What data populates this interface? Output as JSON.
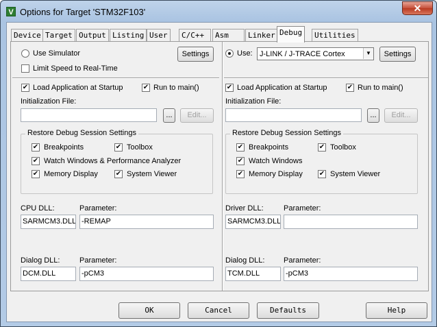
{
  "window": {
    "title": "Options for Target 'STM32F103'",
    "close_glyph": "✕",
    "app_icon_letter": "V"
  },
  "tabs": [
    {
      "label": "Device"
    },
    {
      "label": "Target"
    },
    {
      "label": "Output"
    },
    {
      "label": "Listing"
    },
    {
      "label": "User"
    },
    {
      "label": "C/C++"
    },
    {
      "label": "Asm"
    },
    {
      "label": "Linker"
    },
    {
      "label": "Debug"
    },
    {
      "label": "Utilities"
    }
  ],
  "active_tab": "Debug",
  "left": {
    "use_simulator_label": "Use Simulator",
    "use_simulator_selected": false,
    "settings_label": "Settings",
    "limit_speed_label": "Limit Speed to Real-Time",
    "limit_speed_checked": false,
    "load_app_label": "Load Application at Startup",
    "load_app_checked": true,
    "run_to_main_label": "Run to main()",
    "run_to_main_checked": true,
    "init_file_label": "Initialization File:",
    "init_file_value": "",
    "browse_label": "...",
    "edit_label": "Edit...",
    "restore_group_title": "Restore Debug Session Settings",
    "breakpoints_label": "Breakpoints",
    "toolbox_label": "Toolbox",
    "watch_label": "Watch Windows & Performance Analyzer",
    "memory_label": "Memory Display",
    "system_viewer_label": "System Viewer",
    "cpu_dll_label": "CPU DLL:",
    "cpu_dll_value": "SARMCM3.DLL",
    "cpu_param_label": "Parameter:",
    "cpu_param_value": "-REMAP",
    "dialog_dll_label": "Dialog DLL:",
    "dialog_dll_value": "DCM.DLL",
    "dialog_param_label": "Parameter:",
    "dialog_param_value": "-pCM3"
  },
  "right": {
    "use_label": "Use:",
    "use_selected": true,
    "debugger_value": "J-LINK / J-TRACE Cortex",
    "settings_label": "Settings",
    "load_app_label": "Load Application at Startup",
    "load_app_checked": true,
    "run_to_main_label": "Run to main()",
    "run_to_main_checked": true,
    "init_file_label": "Initialization File:",
    "init_file_value": "",
    "browse_label": "...",
    "edit_label": "Edit...",
    "restore_group_title": "Restore Debug Session Settings",
    "breakpoints_label": "Breakpoints",
    "toolbox_label": "Toolbox",
    "watch_label": "Watch Windows",
    "memory_label": "Memory Display",
    "system_viewer_label": "System Viewer",
    "driver_dll_label": "Driver DLL:",
    "driver_dll_value": "SARMCM3.DLL",
    "driver_param_label": "Parameter:",
    "driver_param_value": "",
    "dialog_dll_label": "Dialog DLL:",
    "dialog_dll_value": "TCM.DLL",
    "dialog_param_label": "Parameter:",
    "dialog_param_value": "-pCM3"
  },
  "footer": {
    "ok": "OK",
    "cancel": "Cancel",
    "defaults": "Defaults",
    "help": "Help"
  },
  "check_glyph": "✔"
}
